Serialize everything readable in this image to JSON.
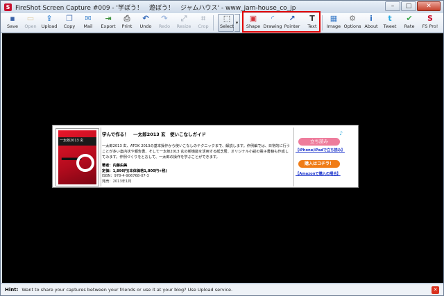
{
  "window": {
    "app_icon_glyph": "S",
    "title": "FireShot Screen Capture #009 - '学ぼう！　遊ぼう！　ジャムハウス' - www_jam-house_co_jp",
    "controls": {
      "minimize": "–",
      "maximize": "□",
      "close": "✕"
    }
  },
  "toolbar": {
    "buttons": [
      {
        "id": "save",
        "label": "Save",
        "icon": "floppy-icon",
        "color": "#3a62a8",
        "enabled": true
      },
      {
        "id": "open",
        "label": "Open",
        "icon": "folder-icon",
        "color": "#c9a24a",
        "enabled": false
      },
      {
        "id": "upload",
        "label": "Upload",
        "icon": "upload-icon",
        "color": "#2f7fd0",
        "enabled": true
      },
      {
        "id": "copy",
        "label": "Copy",
        "icon": "copy-icon",
        "color": "#5b7fb8",
        "enabled": true
      },
      {
        "id": "mail",
        "label": "Mail",
        "icon": "mail-icon",
        "color": "#4b8ccf",
        "enabled": true
      },
      {
        "id": "export",
        "label": "Export",
        "icon": "export-icon",
        "color": "#3a8f3a",
        "enabled": true
      },
      {
        "id": "print",
        "label": "Print",
        "icon": "printer-icon",
        "color": "#6a6a6a",
        "enabled": true
      },
      {
        "id": "undo",
        "label": "Undo",
        "icon": "undo-icon",
        "color": "#2f66b8",
        "enabled": true
      },
      {
        "id": "redo",
        "label": "Redo",
        "icon": "redo-icon",
        "color": "#2f66b8",
        "enabled": false
      },
      {
        "id": "resize",
        "label": "Resize",
        "icon": "resize-icon",
        "color": "#6a7a8c",
        "enabled": false
      },
      {
        "id": "crop",
        "label": "Crop",
        "icon": "crop-icon",
        "color": "#6a7a8c",
        "enabled": false
      },
      {
        "id": "select",
        "label": "Select",
        "icon": "select-icon",
        "color": "#2a2a2a",
        "enabled": true
      },
      {
        "id": "shape",
        "label": "Shape",
        "icon": "shape-icon",
        "color": "#d4343c",
        "enabled": true
      },
      {
        "id": "drawing",
        "label": "Drawing",
        "icon": "drawing-icon",
        "color": "#3b7fd0",
        "enabled": true
      },
      {
        "id": "pointer",
        "label": "Pointer",
        "icon": "pointer-icon",
        "color": "#2f5fb0",
        "enabled": true
      },
      {
        "id": "text",
        "label": "Text",
        "icon": "text-icon",
        "color": "#333333",
        "enabled": true
      },
      {
        "id": "image",
        "label": "Image",
        "icon": "image-icon",
        "color": "#3a7bc8",
        "enabled": true
      },
      {
        "id": "options",
        "label": "Options",
        "icon": "gear-icon",
        "color": "#777777",
        "enabled": true
      },
      {
        "id": "about",
        "label": "About",
        "icon": "info-icon",
        "color": "#2f6fc0",
        "enabled": true
      },
      {
        "id": "tweet",
        "label": "Tweet",
        "icon": "twitter-icon",
        "color": "#29a9e1",
        "enabled": true
      },
      {
        "id": "rate",
        "label": "Rate",
        "icon": "thumbs-up-icon",
        "color": "#3aa74a",
        "enabled": true
      },
      {
        "id": "fspro",
        "label": "FS Pro!",
        "icon": "fireshot-pro-icon",
        "color": "#c8102e",
        "enabled": true
      }
    ],
    "select_dropdown_glyph": "▾",
    "highlight_color": "#e00000"
  },
  "card": {
    "cover": {
      "big_glyph": "一",
      "band_text": "一太郎2013 玄"
    },
    "title": "学んで作る！　一太郎2013 玄　使いこなしガイド",
    "description": "一太郎2013 玄、ATOK 2013の基本操作から使いこなしのテクニックまで、解説します。作例編では、日常的に行うことが多い案内状や報告書、そして一太郎2013 玄の新機能を活用する紙芝居、オリジナル小説の電子書籍も作成してみます。作例づくりをとおして、一太郎の操作を学ぶことができます。",
    "author_line": "著者：内藤由美",
    "price_line": "定価：1,890円(本体価格1,800円+税)",
    "isbn_line": "ISBN：978-4-906768-07-3",
    "release_line": "発売：2013年1月",
    "actions": {
      "note_glyph": "♪",
      "tachiyomi_label": "立ち読み",
      "iphone_link": "【iPhone/iPadで立ち読み】",
      "buy_label": "購入はコチラ！",
      "amazon_link": "【Amazonで購入の場合】"
    }
  },
  "hint": {
    "label": "Hint:",
    "text": "Want to share your captures between your friends or use it at your blog? Use Upload service.",
    "close_glyph": "✕"
  }
}
